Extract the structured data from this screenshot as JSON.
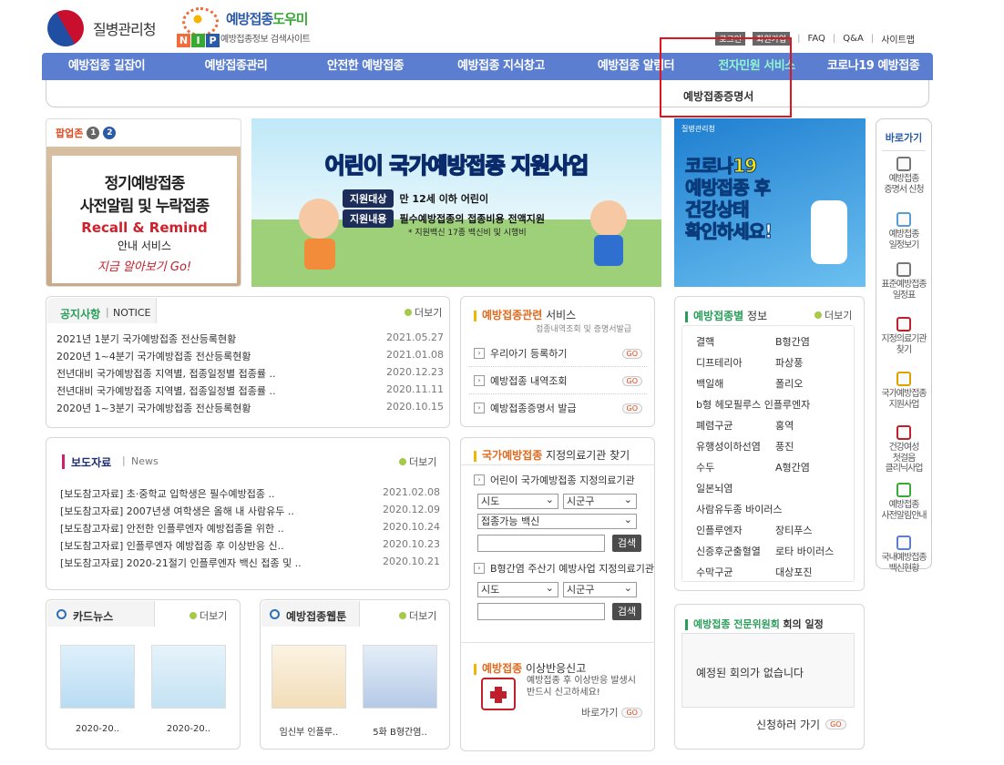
{
  "header": {
    "kdca_name": "질병관리청",
    "nip_title_a": "예방접종",
    "nip_title_b": "도우미",
    "nip_sub": "예방접종정보 검색사이트",
    "nip_letters": [
      "N",
      "I",
      "P"
    ],
    "util_tags": [
      "로그인",
      "회원가입"
    ],
    "util_links": [
      "FAQ",
      "Q&A",
      "사이트맵"
    ]
  },
  "nav": {
    "items": [
      "예방접종 길잡이",
      "예방접종관리",
      "안전한 예방접종",
      "예방접종 지식창고",
      "예방접종 알림터",
      "전자민원 서비스",
      "코로나19 예방접종"
    ],
    "active_index": 5,
    "sub_item": "예방접종증명서"
  },
  "popup": {
    "label": "팝업존",
    "pages": [
      "1",
      "2"
    ],
    "line1": "정기예방접종",
    "line2": "사전알림 및 누락접종",
    "line3": "Recall & Remind",
    "line4": "안내 서비스",
    "line5": "지금 알아보기 Go!"
  },
  "banner1": {
    "title": "어린이 국가예방접종 지원사업",
    "row1_tag": "지원대상",
    "row1_text": "만 12세 이하 어린이",
    "row2_tag": "지원내용",
    "row2_text": "필수예방접종의 접종비용 전액지원",
    "note": "* 지원백신 17종 백신비 및 시행비"
  },
  "banner2": {
    "logo": "질병관리청",
    "line1": "코로나19",
    "line2": "예방접종 후",
    "line3": "건강상태",
    "line4": "확인하세요!"
  },
  "quick": {
    "title": "바로가기",
    "items": [
      {
        "label": "예방접종\n증명서 신청",
        "icon": "printer-icon"
      },
      {
        "label": "예방접종\n일정보기",
        "icon": "calendar-icon"
      },
      {
        "label": "표준예방접종\n일정표",
        "icon": "syringe-icon"
      },
      {
        "label": "지정의료기관\n찾기",
        "icon": "hospital-icon"
      },
      {
        "label": "국가예방접종\n지원사업",
        "icon": "document-icon"
      },
      {
        "label": "건강여성\n첫걸음\n클리닉사업",
        "icon": "box-icon"
      },
      {
        "label": "예방접종\n사전알림안내",
        "icon": "speaker-icon"
      },
      {
        "label": "국내예방접종\n백신현황",
        "icon": "vaccine-icon"
      }
    ]
  },
  "notice": {
    "tab_active": "공지사항",
    "tab_en": "NOTICE",
    "more": "더보기",
    "rows": [
      {
        "title": "2021년 1분기 국가예방접종 전산등록현황",
        "date": "2021.05.27"
      },
      {
        "title": "2020년 1~4분기 국가예방접종 전산등록현황",
        "date": "2021.01.08"
      },
      {
        "title": "전년대비 국가예방접종 지역별, 접종일정별 접종률 ..",
        "date": "2020.12.23"
      },
      {
        "title": "전년대비 국가예방접종 지역별, 접종일정별 접종률 ..",
        "date": "2020.11.11"
      },
      {
        "title": "2020년 1~3분기 국가예방접종 전산등록현황",
        "date": "2020.10.15"
      }
    ]
  },
  "press": {
    "tab_active": "보도자료",
    "tab_en": "News",
    "more": "더보기",
    "rows": [
      {
        "title": "[보도참고자료] 초·중학교 입학생은 필수예방접종 ..",
        "date": "2021.02.08"
      },
      {
        "title": "[보도참고자료] 2007년생 여학생은 올해 내 사람유두 ..",
        "date": "2020.12.09"
      },
      {
        "title": "[보도참고자료] 안전한 인플루엔자 예방접종을 위한 ..",
        "date": "2020.10.24"
      },
      {
        "title": "[보도참고자료] 인플루엔자 예방접종 후 이상반응 신..",
        "date": "2020.10.23"
      },
      {
        "title": "[보도참고자료] 2020-21절기 인플루엔자 백신 접종 및 ..",
        "date": "2020.10.21"
      }
    ]
  },
  "card_news": {
    "tab": "카드뉴스",
    "more": "더보기",
    "items": [
      {
        "caption": "2020-20.."
      },
      {
        "caption": "2020-20.."
      }
    ]
  },
  "webtoon": {
    "tab": "예방접종웹툰",
    "more": "더보기",
    "items": [
      {
        "caption": "임신부 인플루.."
      },
      {
        "caption": "5화 B형간염.."
      }
    ]
  },
  "service": {
    "title_a": "예방접종관련",
    "title_b": "서비스",
    "sub": "접종내역조회 및 증명서발급",
    "rows": [
      "우리아기 등록하기",
      "예방접종 내역조회",
      "예방접종증명서 발급"
    ],
    "go": "GO"
  },
  "clinic": {
    "title_a": "국가예방접종",
    "title_b": "지정의료기관 찾기",
    "sec1": "어린이 국가예방접종 지정의료기관",
    "sec2": "B형간염 주산기 예방사업 지정의료기관",
    "sido": "시도",
    "sigungu": "시군구",
    "vaccine": "접종가능 백신",
    "search": "검색"
  },
  "adverse": {
    "title_a": "예방접종",
    "title_b": "이상반응신고",
    "desc1": "예방접종 후 이상반응 발생시",
    "desc2": "반드시 신고하세요!",
    "link": "바로가기",
    "go": "GO"
  },
  "vaccine_info": {
    "title_a": "예방접종별",
    "title_b": "정보",
    "more": "더보기",
    "left": [
      "결핵",
      "디프테리아",
      "백일해",
      "b형 헤모필루스 인플루엔자",
      "폐렴구균",
      "유행성이하선염",
      "수두",
      "일본뇌염",
      "사람유두종 바이러스",
      "인플루엔자",
      "신증후군출혈열",
      "수막구균"
    ],
    "right": [
      "B형간염",
      "파상풍",
      "폴리오",
      "",
      "홍역",
      "풍진",
      "A형간염",
      "",
      "",
      "장티푸스",
      "로타 바이러스",
      "대상포진"
    ]
  },
  "committee": {
    "title_a": "예방접종 전문위원회",
    "title_b": "회의 일정",
    "empty": "예정된 회의가 없습니다",
    "apply": "신청하러 가기",
    "go": "GO"
  }
}
